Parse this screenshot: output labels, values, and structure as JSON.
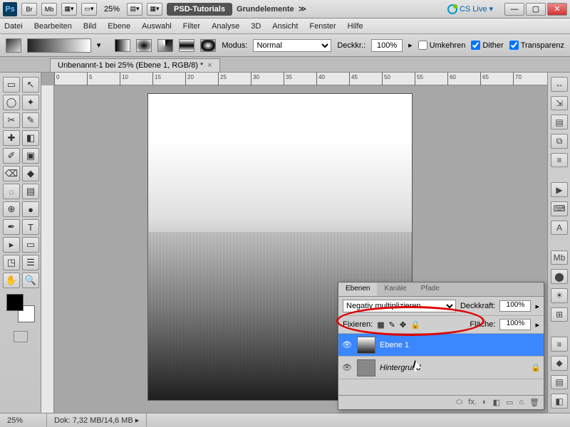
{
  "title": {
    "app": "Ps",
    "mini1": "Br",
    "mini2": "Mb",
    "zoom": "25%",
    "workspace_pill": "PSD-Tutorials",
    "workspace2": "Grundelemente",
    "cslive": "CS Live"
  },
  "menu": [
    "Datei",
    "Bearbeiten",
    "Bild",
    "Ebene",
    "Auswahl",
    "Filter",
    "Analyse",
    "3D",
    "Ansicht",
    "Fenster",
    "Hilfe"
  ],
  "options": {
    "mode_label": "Modus:",
    "mode_value": "Normal",
    "opacity_label": "Deckkr.:",
    "opacity_value": "100%",
    "chk_reverse": "Umkehren",
    "chk_dither": "Dither",
    "chk_trans": "Transparenz"
  },
  "doc_tab": "Unbenannt-1 bei 25% (Ebene 1, RGB/8) *",
  "ruler_ticks": [
    "0",
    "5",
    "10",
    "15",
    "20",
    "25",
    "30",
    "35",
    "40",
    "45",
    "50",
    "55",
    "60",
    "65",
    "70"
  ],
  "status": {
    "zoom": "25%",
    "docsize_label": "Dok:",
    "docsize": "7,32 MB/14,6 MB"
  },
  "layers_panel": {
    "tabs": [
      "Ebenen",
      "Kanäle",
      "Pfade"
    ],
    "active_tab": 0,
    "blend_mode": "Negativ multiplizieren",
    "opacity_label": "Deckkraft:",
    "opacity": "100%",
    "lock_label": "Fixieren:",
    "fill_label": "Fläche:",
    "fill": "100%",
    "items": [
      {
        "name": "Ebene 1",
        "selected": true,
        "locked": false
      },
      {
        "name": "Hintergrund",
        "selected": false,
        "locked": true,
        "italic": true
      }
    ],
    "foot_icons": [
      "⬭",
      "fx.",
      "◐",
      "◧",
      "▭",
      "⌂",
      "🗑"
    ]
  },
  "tool_glyphs": [
    "▭",
    "↖",
    "◯",
    "✦",
    "✂",
    "✎",
    "✚",
    "◧",
    "✐",
    "▣",
    "⌫",
    "◆",
    "◌",
    "▤",
    "⊕",
    "●",
    "✒",
    "T",
    "▸",
    "▭",
    "◳",
    "☰",
    "✋",
    "🔍"
  ],
  "right_glyphs": [
    "↔",
    "⇲",
    "▤",
    "⧉",
    "≡",
    "▶",
    "⌨",
    "A",
    "Mb",
    "⬤",
    "☀",
    "⊞",
    "≡",
    "◆",
    "▤",
    "◧"
  ]
}
